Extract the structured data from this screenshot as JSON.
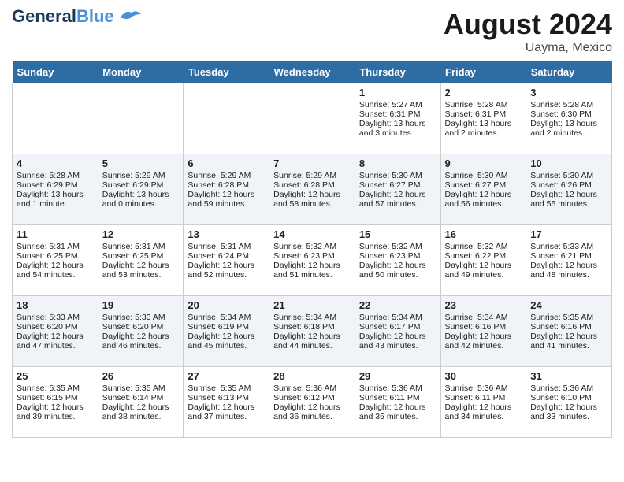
{
  "header": {
    "logo_line1": "General",
    "logo_line2": "Blue",
    "month_year": "August 2024",
    "location": "Uayma, Mexico"
  },
  "weekdays": [
    "Sunday",
    "Monday",
    "Tuesday",
    "Wednesday",
    "Thursday",
    "Friday",
    "Saturday"
  ],
  "weeks": [
    [
      {
        "day": "",
        "content": ""
      },
      {
        "day": "",
        "content": ""
      },
      {
        "day": "",
        "content": ""
      },
      {
        "day": "",
        "content": ""
      },
      {
        "day": "1",
        "content": "Sunrise: 5:27 AM\nSunset: 6:31 PM\nDaylight: 13 hours\nand 3 minutes."
      },
      {
        "day": "2",
        "content": "Sunrise: 5:28 AM\nSunset: 6:31 PM\nDaylight: 13 hours\nand 2 minutes."
      },
      {
        "day": "3",
        "content": "Sunrise: 5:28 AM\nSunset: 6:30 PM\nDaylight: 13 hours\nand 2 minutes."
      }
    ],
    [
      {
        "day": "4",
        "content": "Sunrise: 5:28 AM\nSunset: 6:29 PM\nDaylight: 13 hours\nand 1 minute."
      },
      {
        "day": "5",
        "content": "Sunrise: 5:29 AM\nSunset: 6:29 PM\nDaylight: 13 hours\nand 0 minutes."
      },
      {
        "day": "6",
        "content": "Sunrise: 5:29 AM\nSunset: 6:28 PM\nDaylight: 12 hours\nand 59 minutes."
      },
      {
        "day": "7",
        "content": "Sunrise: 5:29 AM\nSunset: 6:28 PM\nDaylight: 12 hours\nand 58 minutes."
      },
      {
        "day": "8",
        "content": "Sunrise: 5:30 AM\nSunset: 6:27 PM\nDaylight: 12 hours\nand 57 minutes."
      },
      {
        "day": "9",
        "content": "Sunrise: 5:30 AM\nSunset: 6:27 PM\nDaylight: 12 hours\nand 56 minutes."
      },
      {
        "day": "10",
        "content": "Sunrise: 5:30 AM\nSunset: 6:26 PM\nDaylight: 12 hours\nand 55 minutes."
      }
    ],
    [
      {
        "day": "11",
        "content": "Sunrise: 5:31 AM\nSunset: 6:25 PM\nDaylight: 12 hours\nand 54 minutes."
      },
      {
        "day": "12",
        "content": "Sunrise: 5:31 AM\nSunset: 6:25 PM\nDaylight: 12 hours\nand 53 minutes."
      },
      {
        "day": "13",
        "content": "Sunrise: 5:31 AM\nSunset: 6:24 PM\nDaylight: 12 hours\nand 52 minutes."
      },
      {
        "day": "14",
        "content": "Sunrise: 5:32 AM\nSunset: 6:23 PM\nDaylight: 12 hours\nand 51 minutes."
      },
      {
        "day": "15",
        "content": "Sunrise: 5:32 AM\nSunset: 6:23 PM\nDaylight: 12 hours\nand 50 minutes."
      },
      {
        "day": "16",
        "content": "Sunrise: 5:32 AM\nSunset: 6:22 PM\nDaylight: 12 hours\nand 49 minutes."
      },
      {
        "day": "17",
        "content": "Sunrise: 5:33 AM\nSunset: 6:21 PM\nDaylight: 12 hours\nand 48 minutes."
      }
    ],
    [
      {
        "day": "18",
        "content": "Sunrise: 5:33 AM\nSunset: 6:20 PM\nDaylight: 12 hours\nand 47 minutes."
      },
      {
        "day": "19",
        "content": "Sunrise: 5:33 AM\nSunset: 6:20 PM\nDaylight: 12 hours\nand 46 minutes."
      },
      {
        "day": "20",
        "content": "Sunrise: 5:34 AM\nSunset: 6:19 PM\nDaylight: 12 hours\nand 45 minutes."
      },
      {
        "day": "21",
        "content": "Sunrise: 5:34 AM\nSunset: 6:18 PM\nDaylight: 12 hours\nand 44 minutes."
      },
      {
        "day": "22",
        "content": "Sunrise: 5:34 AM\nSunset: 6:17 PM\nDaylight: 12 hours\nand 43 minutes."
      },
      {
        "day": "23",
        "content": "Sunrise: 5:34 AM\nSunset: 6:16 PM\nDaylight: 12 hours\nand 42 minutes."
      },
      {
        "day": "24",
        "content": "Sunrise: 5:35 AM\nSunset: 6:16 PM\nDaylight: 12 hours\nand 41 minutes."
      }
    ],
    [
      {
        "day": "25",
        "content": "Sunrise: 5:35 AM\nSunset: 6:15 PM\nDaylight: 12 hours\nand 39 minutes."
      },
      {
        "day": "26",
        "content": "Sunrise: 5:35 AM\nSunset: 6:14 PM\nDaylight: 12 hours\nand 38 minutes."
      },
      {
        "day": "27",
        "content": "Sunrise: 5:35 AM\nSunset: 6:13 PM\nDaylight: 12 hours\nand 37 minutes."
      },
      {
        "day": "28",
        "content": "Sunrise: 5:36 AM\nSunset: 6:12 PM\nDaylight: 12 hours\nand 36 minutes."
      },
      {
        "day": "29",
        "content": "Sunrise: 5:36 AM\nSunset: 6:11 PM\nDaylight: 12 hours\nand 35 minutes."
      },
      {
        "day": "30",
        "content": "Sunrise: 5:36 AM\nSunset: 6:11 PM\nDaylight: 12 hours\nand 34 minutes."
      },
      {
        "day": "31",
        "content": "Sunrise: 5:36 AM\nSunset: 6:10 PM\nDaylight: 12 hours\nand 33 minutes."
      }
    ]
  ]
}
